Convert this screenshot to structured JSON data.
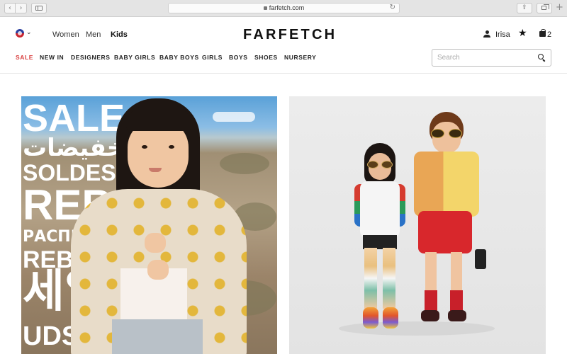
{
  "browser": {
    "back_icon": "‹",
    "forward_icon": "›",
    "url": "farfetch.com",
    "reload_icon": "↻",
    "share_icon": "⇧",
    "new_tab_icon": "+"
  },
  "header": {
    "departments": [
      "Women",
      "Men",
      "Kids"
    ],
    "active_department": "Kids",
    "logo": "FARFETCH",
    "user_name": "Irisa",
    "wishlist_icon": "★",
    "bag_count": "2",
    "country_chevron": "⌄"
  },
  "nav": {
    "items": [
      "SALE",
      "NEW IN",
      "DESIGNERS",
      "BABY GIRLS",
      "BABY BOYS",
      "GIRLS",
      "BOYS",
      "SHOES",
      "NURSERY"
    ]
  },
  "search": {
    "placeholder": "Search",
    "value": ""
  },
  "hero_left": {
    "words": [
      "SALE",
      "تخفيضات",
      "SOLDES",
      "REBA",
      "РАСПРО",
      "REBA",
      "세일",
      "UDSAL"
    ]
  },
  "colors": {
    "sale_red": "#d93f3f",
    "text": "#222222"
  }
}
